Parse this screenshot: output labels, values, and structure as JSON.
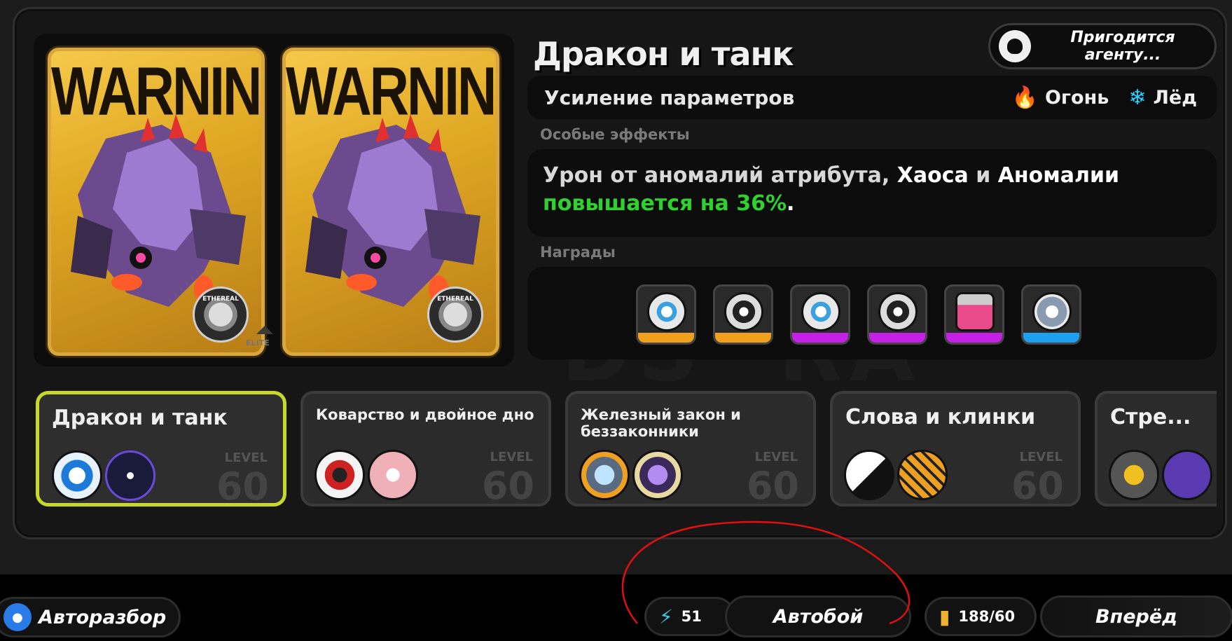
{
  "header": {
    "title": "Дракон и танк",
    "agent_button_label": "Пригодится агенту..."
  },
  "cards": {
    "card_text": "WARNING",
    "emblem_text": "ETHEREAL",
    "tier_label": "ELITE"
  },
  "stats": {
    "label": "Усиление параметров",
    "elements": [
      {
        "icon": "fire-icon",
        "label": "Огонь",
        "color": "#ff5a2a"
      },
      {
        "icon": "ice-icon",
        "label": "Лёд",
        "color": "#28d4ff"
      }
    ]
  },
  "effects": {
    "heading": "Особые эффекты",
    "line1_a": "Урон от аномалий атрибута,",
    "line1_b": "Хаоса",
    "line1_c": "и",
    "line1_d": "Аномалии",
    "line2_a": "повышается на 36%",
    "line2_b": "."
  },
  "rewards": {
    "heading": "Награды",
    "items": [
      {
        "rarity": "gold",
        "color": "#f0a01a"
      },
      {
        "rarity": "gold",
        "color": "#f0a01a"
      },
      {
        "rarity": "purple",
        "color": "#c51fe8"
      },
      {
        "rarity": "purple",
        "color": "#c51fe8"
      },
      {
        "rarity": "purple",
        "color": "#c51fe8"
      },
      {
        "rarity": "blue",
        "color": "#1ea0f0"
      }
    ]
  },
  "stages": [
    {
      "name": "Дракон и танк",
      "level_label": "LEVEL",
      "level": "60",
      "active": true
    },
    {
      "name": "Коварство и двойное дно",
      "level_label": "LEVEL",
      "level": "60",
      "active": false
    },
    {
      "name": "Железный закон и беззаконники",
      "level_label": "LEVEL",
      "level": "60",
      "active": false
    },
    {
      "name": "Слова и клинки",
      "level_label": "LEVEL",
      "level": "60",
      "active": false
    },
    {
      "name": "Стре...",
      "level_label": "",
      "level": "",
      "active": false
    }
  ],
  "bottom": {
    "autodisassemble_label": "Авторазбор",
    "energy_value": "51",
    "autobattle_label": "Автобой",
    "fuel_value": "188/60",
    "forward_label": "Вперёд"
  },
  "colors": {
    "active_border": "#c6d82a",
    "green_text": "#2fd12f",
    "annotation": "#e01010"
  }
}
